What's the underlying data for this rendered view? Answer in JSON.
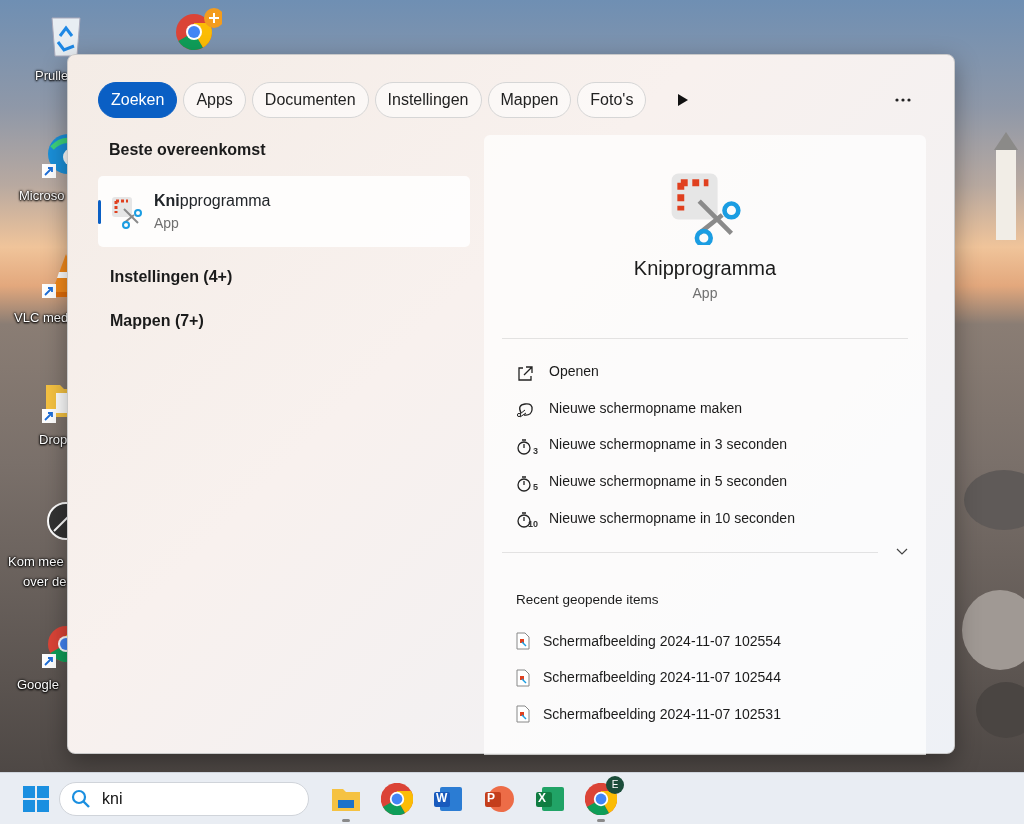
{
  "desktop": {
    "icons": [
      {
        "kind": "recycle",
        "lines": [
          "Prulle"
        ]
      },
      {
        "kind": "edge",
        "lines": [
          "Microso"
        ]
      },
      {
        "kind": "vlc",
        "lines": [
          "VLC med"
        ]
      },
      {
        "kind": "folder",
        "lines": [
          "Drop"
        ]
      },
      {
        "kind": "help",
        "lines": [
          "Kom mee",
          "over de"
        ]
      },
      {
        "kind": "chrome",
        "lines": [
          "Google"
        ]
      },
      {
        "kind": "chrome-badge"
      }
    ]
  },
  "search_panel": {
    "tabs": [
      {
        "label": "Zoeken",
        "selected": true
      },
      {
        "label": "Apps",
        "selected": false
      },
      {
        "label": "Documenten",
        "selected": false
      },
      {
        "label": "Instellingen",
        "selected": false
      },
      {
        "label": "Mappen",
        "selected": false
      },
      {
        "label": "Foto's",
        "selected": false
      }
    ],
    "best_match": {
      "heading": "Beste overeenkomst",
      "title": "**Kni**pprogramma",
      "subtitle": "App",
      "selected": true
    },
    "categories": [
      "Instellingen (4+)",
      "Mappen (7+)"
    ],
    "detail": {
      "title": "Knipprogramma",
      "subtitle": "App",
      "actions": [
        {
          "kind": "open",
          "label": "Openen"
        },
        {
          "kind": "snip",
          "label": "Nieuwe schermopname maken"
        },
        {
          "kind": "timer",
          "digit": "3",
          "label": "Nieuwe schermopname in 3 seconden"
        },
        {
          "kind": "timer",
          "digit": "5",
          "label": "Nieuwe schermopname in 5 seconden"
        },
        {
          "kind": "timer",
          "digit": "10",
          "label": "Nieuwe schermopname in 10 seconden"
        }
      ],
      "recent_heading": "Recent geopende items",
      "recent": [
        "Schermafbeelding 2024-11-07 102554",
        "Schermafbeelding 2024-11-07 102544",
        "Schermafbeelding 2024-11-07 102531"
      ]
    }
  },
  "taskbar": {
    "search": {
      "value": "kni"
    },
    "apps": [
      {
        "kind": "folder",
        "running": true
      },
      {
        "kind": "chrome",
        "running": false
      },
      {
        "kind": "word",
        "letter": "W",
        "running": false
      },
      {
        "kind": "powerpoint",
        "letter": "P",
        "running": false
      },
      {
        "kind": "excel",
        "letter": "X",
        "running": false
      },
      {
        "kind": "chrome",
        "badge": "E",
        "running": true
      }
    ]
  }
}
